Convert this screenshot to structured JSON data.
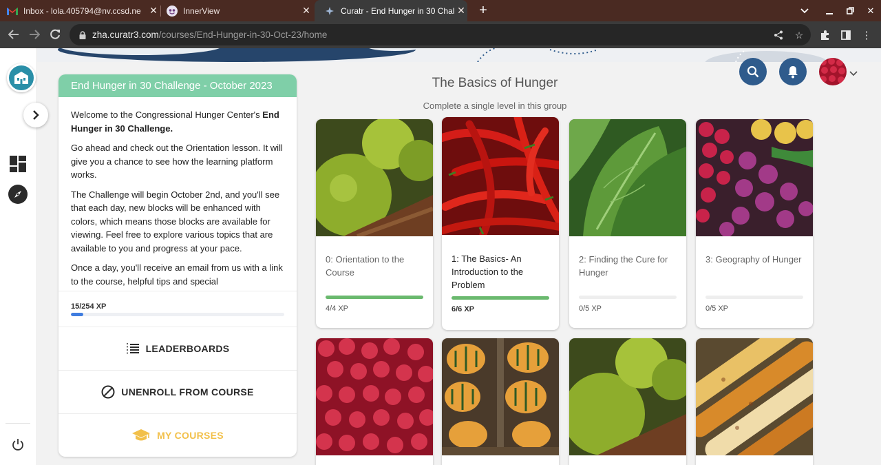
{
  "browser": {
    "tabs": [
      {
        "title": "Inbox - lola.405794@nv.ccsd.ne",
        "icon": "gmail-icon"
      },
      {
        "title": "InnerView",
        "icon": "innerview-icon"
      },
      {
        "title": "Curatr - End Hunger in 30 Challe",
        "icon": "curatr-icon"
      }
    ],
    "url_host": "zha.curatr3.com",
    "url_path": "/courses/End-Hunger-in-30-Oct-23/home"
  },
  "course": {
    "title": "End Hunger in 30 Challenge - October 2023",
    "intro_prefix": "Welcome to the Congressional Hunger Center's ",
    "intro_bold": "End Hunger in 30 Challenge.",
    "paragraph2": "Go ahead and check out the Orientation lesson. It will give you a chance to see how the learning platform works.",
    "paragraph3": "The Challenge will begin October 2nd, and you'll see that each day, new blocks will be enhanced with colors, which means those blocks are available for viewing. Feel free to explore various topics that are available to you and progress at your pace.",
    "paragraph4": "Once a day, you'll receive an email from us with a link to the course, helpful tips and special announcements",
    "xp_label": "15/254 XP",
    "xp_fraction": 0.059
  },
  "menu": {
    "leaderboards": "LEADERBOARDS",
    "unenroll": "UNENROLL FROM COURSE",
    "my_courses": "MY COURSES"
  },
  "group": {
    "title": "The Basics of Hunger",
    "subtitle": "Complete a single level in this group"
  },
  "levels": [
    {
      "title": "0: Orientation to the Course",
      "xp": "4/4 XP",
      "progress": 1.0
    },
    {
      "title": "1: The Basics- An Introduction to the Problem",
      "xp": "6/6 XP",
      "progress": 1.0
    },
    {
      "title": "2: Finding the Cure for Hunger",
      "xp": "0/5 XP",
      "progress": 0
    },
    {
      "title": "3: Geography of Hunger",
      "xp": "0/5 XP",
      "progress": 0
    }
  ],
  "colors": {
    "header_green": "#7fcfa8",
    "progress_green": "#6ab96e",
    "xp_blue": "#3f7de0",
    "action_blue": "#2f5b8c",
    "gold": "#f2c04a"
  }
}
